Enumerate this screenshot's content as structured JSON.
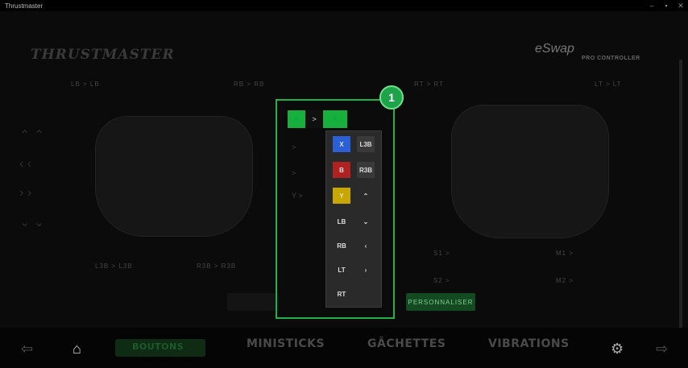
{
  "window": {
    "title": "Thrustmaster",
    "controls": [
      "–",
      "▪",
      "✕"
    ]
  },
  "header": {
    "brand": "THRUSTMASTER",
    "brand_sub": "",
    "brand_sub2": "",
    "product_logo": "eSwap",
    "product_sub": "PRO CONTROLLER"
  },
  "map_labels": {
    "lb": "LB > LB",
    "rb": "RB > RB",
    "rt": "RT > RT",
    "lt": "LT > LT",
    "l3": "L3B > L3B",
    "r3": "R3B > R3B"
  },
  "remap": {
    "top_left": "A",
    "top_mid": ">",
    "top_right": "A",
    "rows": [
      ">",
      ">",
      "Y >"
    ],
    "picker": [
      {
        "label": "X",
        "color": "#2a5fd8"
      },
      {
        "label": "L3B",
        "color": "#3a3a3a"
      },
      {
        "label": "B",
        "color": "#b02222"
      },
      {
        "label": "R3B",
        "color": "#3a3a3a"
      },
      {
        "label": "Y",
        "color": "#c8a800"
      },
      {
        "label": "⌃",
        "color": "#2a2a2a"
      },
      {
        "label": "LB",
        "color": "#2a2a2a"
      },
      {
        "label": "⌄",
        "color": "#2a2a2a"
      },
      {
        "label": "RB",
        "color": "#2a2a2a"
      },
      {
        "label": "‹",
        "color": "#2a2a2a"
      },
      {
        "label": "LT",
        "color": "#2a2a2a"
      },
      {
        "label": "›",
        "color": "#2a2a2a"
      },
      {
        "label": "RT",
        "color": "#2a2a2a"
      }
    ],
    "badge": "1"
  },
  "right_labels": {
    "s1": "S1 >",
    "s2": "S2 >",
    "m1": "M1 >",
    "m2": "M2 >"
  },
  "actions": {
    "left": "",
    "mid": "",
    "right": "PERSONNALISER"
  },
  "nav": {
    "home_selected": "BOUTONS",
    "items": [
      "MINISTICKS",
      "GÂCHETTES",
      "VIBRATIONS"
    ]
  },
  "colors": {
    "accent": "#22b04a",
    "bg": "#0b0b0b"
  }
}
